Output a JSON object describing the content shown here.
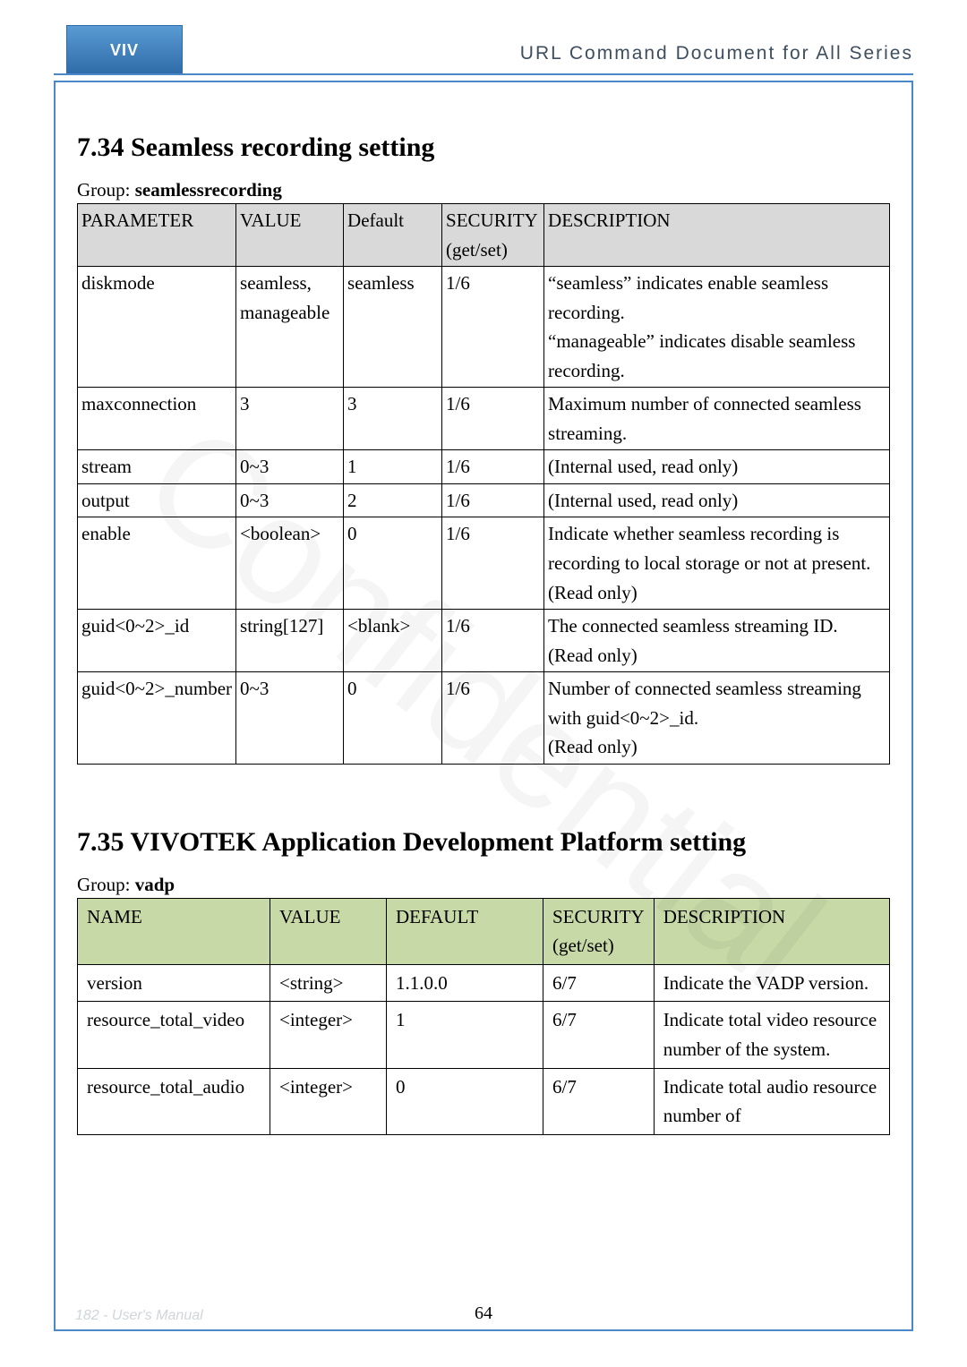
{
  "header": {
    "logo_text": "VIV",
    "logo_sub": "",
    "doc_title": "URL Command Document for All Series"
  },
  "section_734": {
    "heading": "7.34 Seamless recording setting",
    "group_prefix": "Group: ",
    "group_name": "seamlessrecording",
    "cols": {
      "c1": "PARAMETER",
      "c2": "VALUE",
      "c3": "Default",
      "c4": "SECURITY (get/set)",
      "c5": "DESCRIPTION"
    },
    "rows": [
      {
        "param": "diskmode",
        "value": "seamless, manageable",
        "default": "seamless",
        "security": "1/6",
        "desc": "“seamless” indicates enable seamless recording.\n“manageable” indicates disable seamless recording."
      },
      {
        "param": "maxconnection",
        "value": "3",
        "default": "3",
        "security": "1/6",
        "desc": "Maximum number of connected seamless streaming."
      },
      {
        "param": "stream",
        "value": "0~3",
        "default": "1",
        "security": "1/6",
        "desc": "(Internal used, read only)"
      },
      {
        "param": "output",
        "value": "0~3",
        "default": "2",
        "security": "1/6",
        "desc": "(Internal used, read only)"
      },
      {
        "param": "enable",
        "value": "<boolean>",
        "default": "0",
        "security": "1/6",
        "desc": "Indicate whether seamless recording is recording to local storage or not at present.\n(Read only)"
      },
      {
        "param": "guid<0~2>_id",
        "value": "string[127]",
        "default": "<blank>",
        "security": "1/6",
        "desc": "The connected seamless streaming ID.\n(Read only)"
      },
      {
        "param": "guid<0~2>_number",
        "value": "0~3",
        "default": "0",
        "security": "1/6",
        "desc": "Number of connected seamless streaming with guid<0~2>_id.\n(Read only)"
      }
    ]
  },
  "section_735": {
    "heading": "7.35 VIVOTEK Application Development Platform setting",
    "group_prefix": "Group: ",
    "group_name": "vadp",
    "cols": {
      "c1": "NAME",
      "c2": "VALUE",
      "c3": "DEFAULT",
      "c4": "SECURITY (get/set)",
      "c5": "DESCRIPTION"
    },
    "rows": [
      {
        "name": "version",
        "value": "<string>",
        "default": "1.1.0.0",
        "security": "6/7",
        "desc": "Indicate the VADP version."
      },
      {
        "name": "resource_total_video",
        "value": "<integer>",
        "default": "1",
        "security": "6/7",
        "desc": "Indicate total video resource number of the system."
      },
      {
        "name": "resource_total_audio",
        "value": "<integer>",
        "default": "0",
        "security": "6/7",
        "desc": "Indicate total audio resource number of"
      }
    ]
  },
  "footer": {
    "left": "182 - User's Manual",
    "center": "64"
  }
}
